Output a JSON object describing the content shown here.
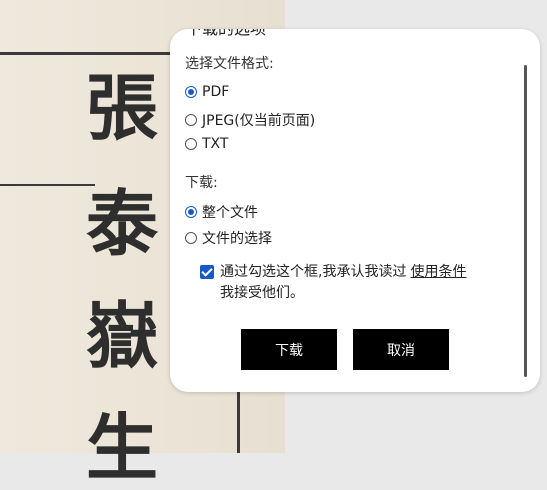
{
  "background": {
    "scan_characters": [
      "張",
      "泰",
      "嶽",
      "生"
    ]
  },
  "dialog": {
    "title": "下载的选项",
    "format_label": "选择文件格式:",
    "formats": [
      {
        "label": "PDF",
        "checked": true
      },
      {
        "label": "JPEG(仅当前页面)",
        "checked": false
      },
      {
        "label": "TXT",
        "checked": false
      }
    ],
    "download_label": "下载:",
    "download_options": [
      {
        "label": "整个文件",
        "checked": true
      },
      {
        "label": "文件的选择",
        "checked": false
      }
    ],
    "terms": {
      "text_before": "通过勾选这个框,我承认我读过",
      "link": "使用条件",
      "text_after": "我接受他们。",
      "checked": true
    },
    "download_button": "下载",
    "cancel_button": "取消"
  },
  "colors": {
    "accent": "#1a57c9",
    "button_bg": "#000000"
  }
}
